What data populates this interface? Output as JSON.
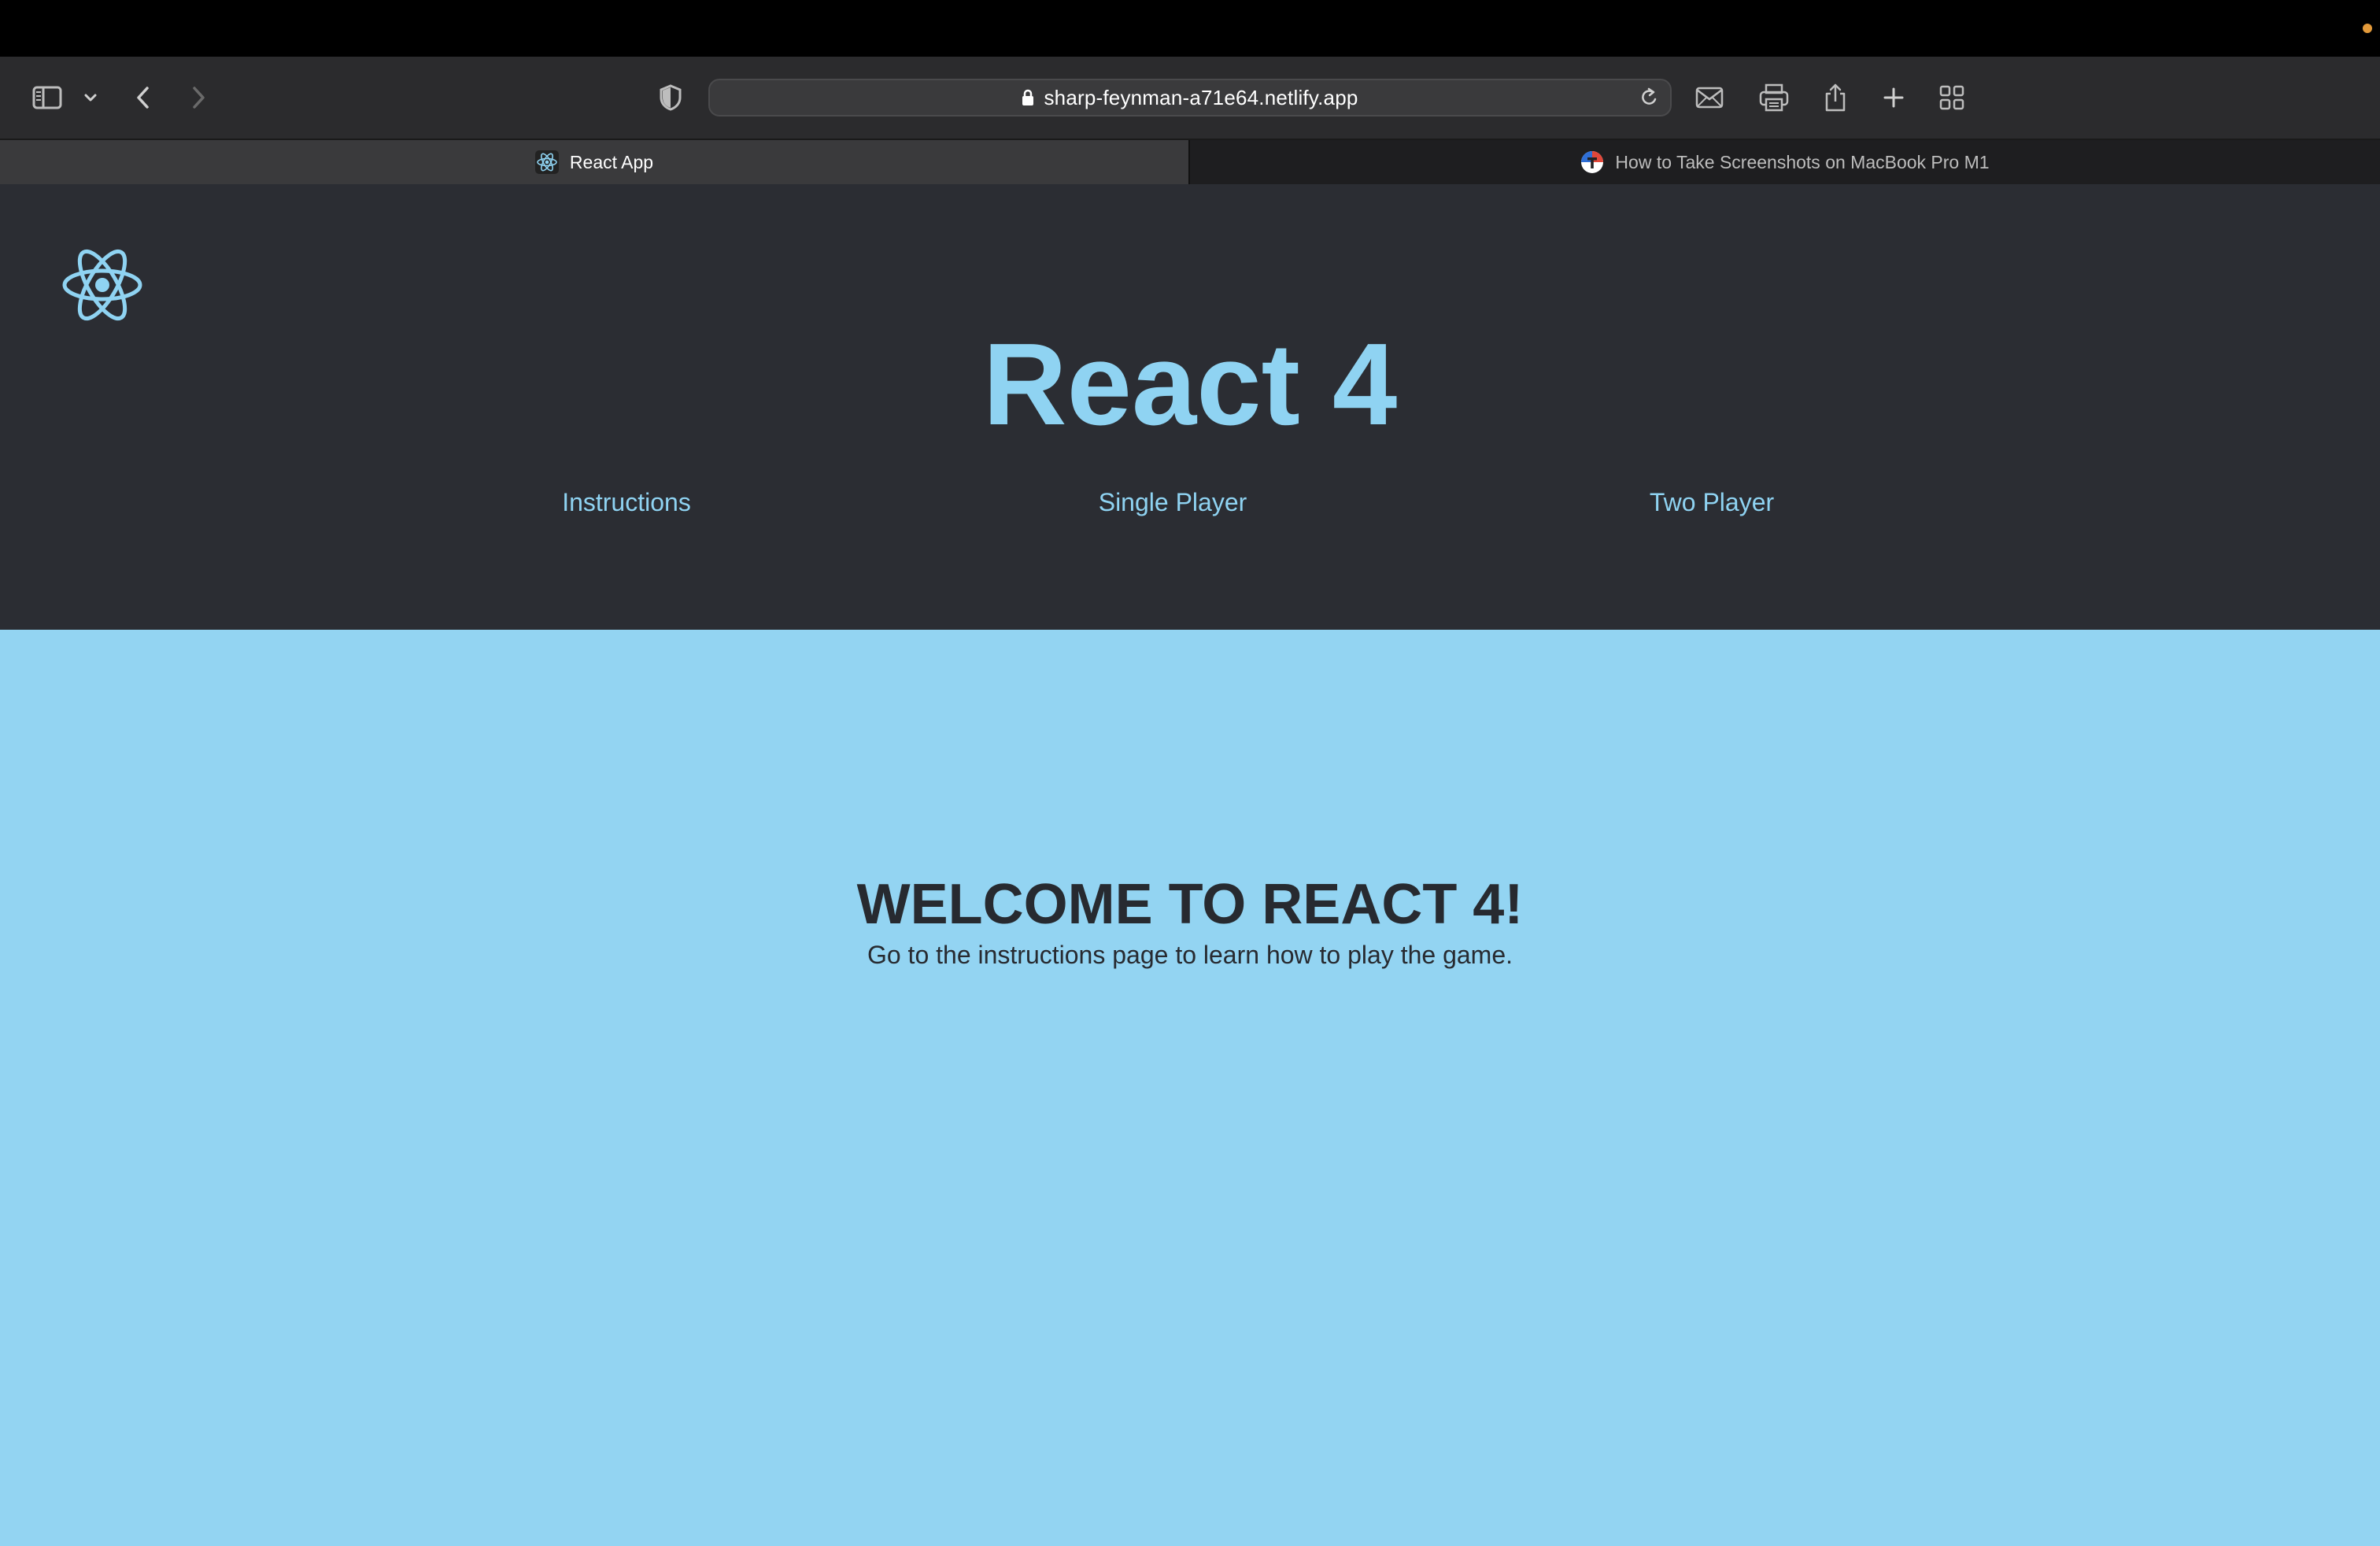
{
  "browser": {
    "url": "sharp-feynman-a71e64.netlify.app",
    "tabs": [
      {
        "label": "React App",
        "active": true,
        "icon": "react-icon"
      },
      {
        "label": "How to Take Screenshots on MacBook Pro M1",
        "active": false,
        "icon": "site-favicon"
      }
    ]
  },
  "header": {
    "title": "React 4",
    "nav": [
      {
        "label": "Instructions"
      },
      {
        "label": "Single Player"
      },
      {
        "label": "Two Player"
      }
    ]
  },
  "main": {
    "heading": "WELCOME TO REACT 4!",
    "subtitle": "Go to the instructions page to learn how to play the game."
  },
  "colors": {
    "header_bg": "#2b2d33",
    "accent": "#8fd3f2",
    "main_bg": "#93d4f2",
    "text_dark": "#272a30"
  }
}
